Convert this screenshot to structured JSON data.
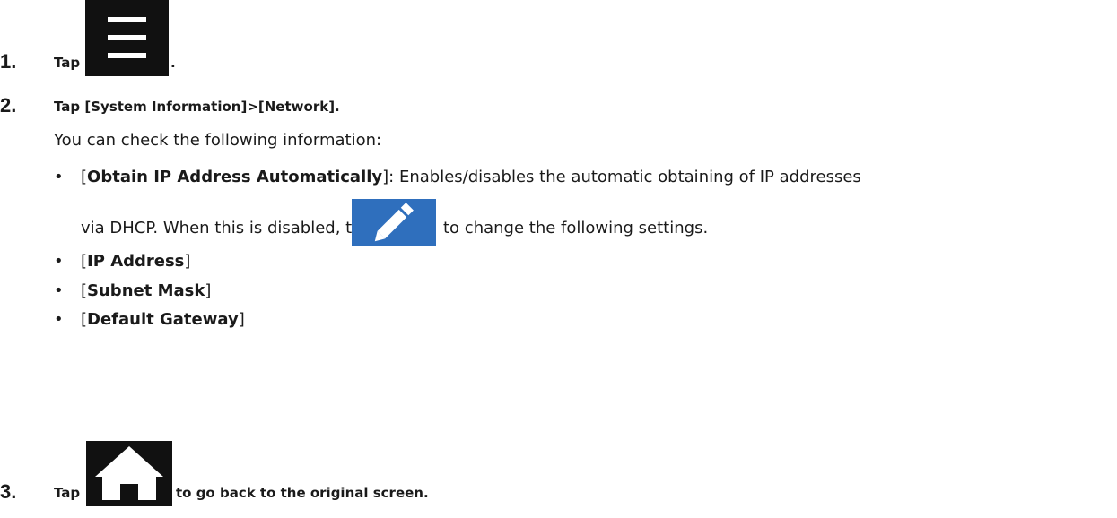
{
  "steps": [
    {
      "number": "1.",
      "prefix": "Tap",
      "suffix": ".",
      "icon": "menu-icon"
    },
    {
      "number": "2.",
      "text": "Tap [System Information]>[Network]."
    },
    {
      "number": "3.",
      "prefix": "Tap",
      "suffix": "to go back to the original screen.",
      "icon": "home-icon"
    }
  ],
  "intro": "You can check the following information:",
  "bullets": {
    "obtain_ip": {
      "name": "Obtain IP Address Automatically",
      "description": ": Enables/disables the automatic obtaining of IP addresses",
      "continuation_before": "via DHCP. When this is disabled, tap",
      "continuation_after": "to change the following settings.",
      "icon": "edit-pencil-icon"
    },
    "ip_address": "IP Address",
    "subnet_mask": "Subnet Mask",
    "default_gateway": "Default Gateway"
  },
  "colors": {
    "icon_dark": "#111111",
    "edit_blue": "#2f6fbd"
  }
}
